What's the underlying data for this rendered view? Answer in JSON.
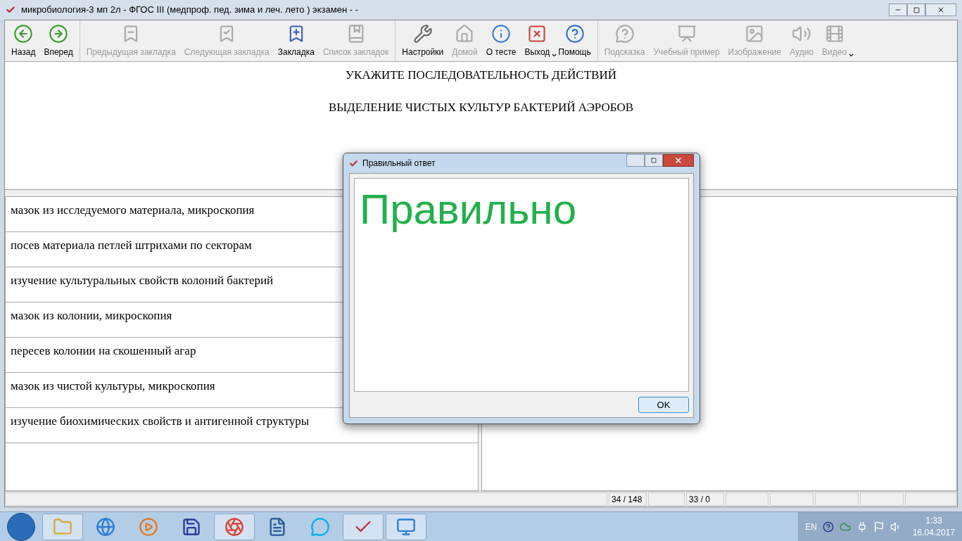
{
  "window": {
    "title": "микробиология-3 мп 2л - ФГОС III (медпроф. пед. зима и леч. лето ) экзамен -  -"
  },
  "toolbar": {
    "groups": [
      {
        "items": [
          {
            "label": "Назад",
            "disabled": false,
            "dropdown": false
          },
          {
            "label": "Вперед",
            "disabled": false,
            "dropdown": false
          }
        ]
      },
      {
        "items": [
          {
            "label": "Предыдущая закладка",
            "disabled": true,
            "dropdown": false
          },
          {
            "label": "Следующая закладка",
            "disabled": true,
            "dropdown": false
          },
          {
            "label": "Закладка",
            "disabled": false,
            "dropdown": false
          },
          {
            "label": "Список закладок",
            "disabled": true,
            "dropdown": false
          }
        ]
      },
      {
        "items": [
          {
            "label": "Настройки",
            "disabled": false,
            "dropdown": false
          },
          {
            "label": "Домой",
            "disabled": true,
            "dropdown": false
          },
          {
            "label": "О тесте",
            "disabled": false,
            "dropdown": false
          },
          {
            "label": "Выход",
            "disabled": false,
            "dropdown": true
          },
          {
            "label": "Помощь",
            "disabled": false,
            "dropdown": false
          }
        ]
      },
      {
        "items": [
          {
            "label": "Подсказка",
            "disabled": true,
            "dropdown": false
          },
          {
            "label": "Учебный пример",
            "disabled": true,
            "dropdown": false
          },
          {
            "label": "Изображение",
            "disabled": true,
            "dropdown": false
          },
          {
            "label": "Аудио",
            "disabled": true,
            "dropdown": false
          },
          {
            "label": "Видео",
            "disabled": true,
            "dropdown": true
          }
        ]
      }
    ]
  },
  "question": {
    "instruction": "УКАЖИТЕ ПОСЛЕДОВАТЕЛЬНОСТЬ ДЕЙСТВИЙ",
    "title": "ВЫДЕЛЕНИЕ ЧИСТЫХ КУЛЬТУР БАКТЕРИЙ АЭРОБОВ"
  },
  "answers": [
    "мазок из исследуемого материала, микроскопия",
    "посев материала петлей штрихами по секторам",
    "изучение культуральных свойств колоний бактерий",
    "мазок из колонии, микроскопия",
    "пересев колонии на скошенный агар",
    "мазок из чистой культуры, микроскопия",
    "изучение биохимических свойств и антигенной структуры"
  ],
  "status_bar": {
    "cell_2": "34 / 148",
    "cell_4": "33 / 0"
  },
  "dialog": {
    "title": "Правильный ответ",
    "message": "Правильно",
    "ok_button": "OK"
  },
  "taskbar": {
    "items": [
      {
        "running": true
      },
      {
        "running": false
      },
      {
        "running": false
      },
      {
        "running": false
      },
      {
        "running": true
      },
      {
        "running": false
      },
      {
        "running": false
      },
      {
        "running": true
      },
      {
        "running": true
      }
    ],
    "language": "EN",
    "time": "1:33",
    "date": "16.04.2017"
  }
}
